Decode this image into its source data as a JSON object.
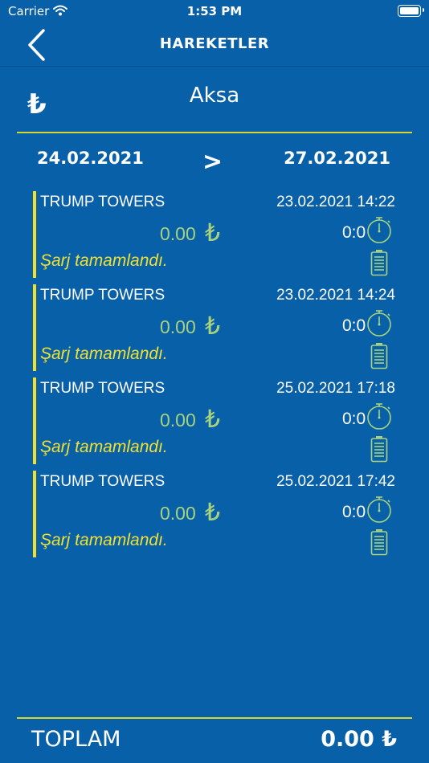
{
  "status_bar": {
    "carrier": "Carrier",
    "time": "1:53 PM"
  },
  "nav": {
    "title": "HAREKETLER"
  },
  "header": {
    "currency_symbol": "₺",
    "user_name": "Aksa"
  },
  "date_range": {
    "start": "24.02.2021",
    "arrow": ">",
    "end": "27.02.2021"
  },
  "transactions": [
    {
      "station": "TRUMP TOWERS",
      "datetime": "23.02.2021 14:22",
      "amount": "0.00",
      "currency": "₺",
      "duration": "0:0",
      "status": "Şarj tamamlandı."
    },
    {
      "station": "TRUMP TOWERS",
      "datetime": "23.02.2021 14:24",
      "amount": "0.00",
      "currency": "₺",
      "duration": "0:0",
      "status": "Şarj tamamlandı."
    },
    {
      "station": "TRUMP TOWERS",
      "datetime": "25.02.2021 17:18",
      "amount": "0.00",
      "currency": "₺",
      "duration": "0:0",
      "status": "Şarj tamamlandı."
    },
    {
      "station": "TRUMP TOWERS",
      "datetime": "25.02.2021 17:42",
      "amount": "0.00",
      "currency": "₺",
      "duration": "0:0",
      "status": "Şarj tamamlandı."
    }
  ],
  "footer": {
    "total_label": "TOPLAM",
    "total_value": "0.00 ₺"
  },
  "colors": {
    "background": "#0860A8",
    "accent_yellow": "#F0E032",
    "divider": "#D8D62E",
    "amount_green": "#A8D37E"
  },
  "icons": {
    "back": "chevron-left-icon",
    "duration": "stopwatch-icon",
    "charge": "battery-icon",
    "wifi": "wifi-icon"
  }
}
